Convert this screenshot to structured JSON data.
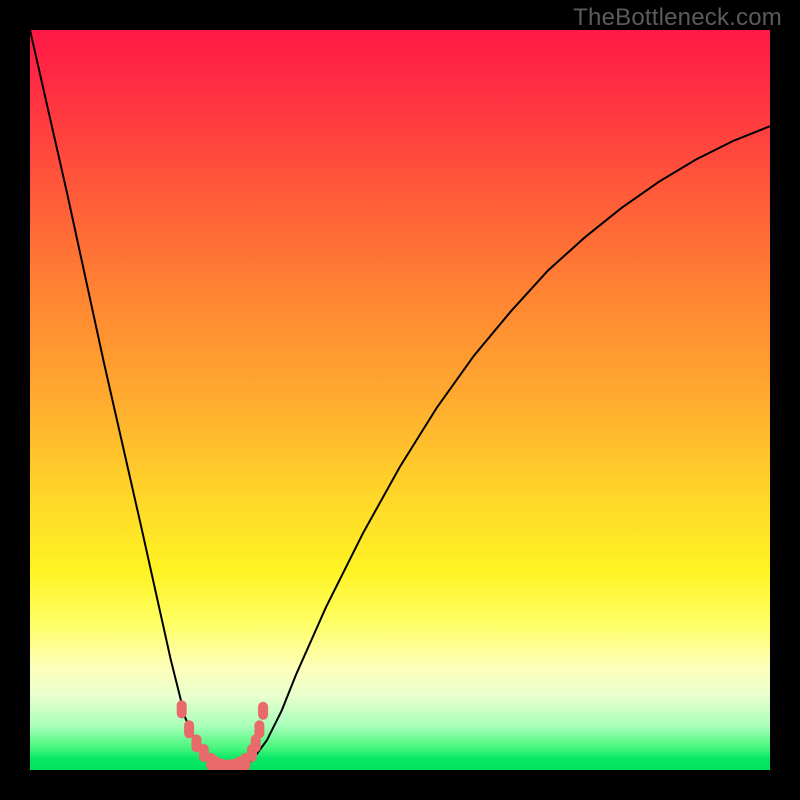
{
  "watermark": "TheBottleneck.com",
  "colors": {
    "page_bg": "#000000",
    "curve": "#000000",
    "points": "#e86a6a",
    "gradient_top": "#ff1846",
    "gradient_bottom": "#00e35f"
  },
  "chart_data": {
    "type": "line",
    "title": "",
    "xlabel": "",
    "ylabel": "",
    "xlim": [
      0,
      100
    ],
    "ylim": [
      0,
      100
    ],
    "grid": false,
    "legend": false,
    "gradient_meaning": "background encodes y-value (red=high/bad, green=low/good)",
    "x": [
      0,
      5,
      10,
      15,
      17,
      19,
      21,
      23,
      24,
      25,
      26,
      27,
      28,
      29,
      30,
      32,
      34,
      36,
      40,
      45,
      50,
      55,
      60,
      65,
      70,
      75,
      80,
      85,
      90,
      95,
      100
    ],
    "series": [
      {
        "name": "bottleneck-curve",
        "values": [
          100,
          78,
          55,
          33,
          24,
          15,
          7,
          2.5,
          1.2,
          0.6,
          0.3,
          0.2,
          0.3,
          0.7,
          1.3,
          4,
          8,
          13,
          22,
          32,
          41,
          49,
          56,
          62,
          67.5,
          72,
          76,
          79.5,
          82.5,
          85,
          87
        ]
      }
    ],
    "highlight_points": {
      "name": "highlighted-range",
      "x": [
        20.5,
        21.5,
        22.5,
        23.5,
        24.5,
        25.2,
        26,
        26.8,
        27.5,
        28.3,
        29.1,
        30.0,
        30.5,
        31,
        31.5
      ],
      "y": [
        8.2,
        5.5,
        3.6,
        2.3,
        1.1,
        0.6,
        0.3,
        0.2,
        0.3,
        0.6,
        1.1,
        2.3,
        3.6,
        5.5,
        8
      ]
    }
  }
}
